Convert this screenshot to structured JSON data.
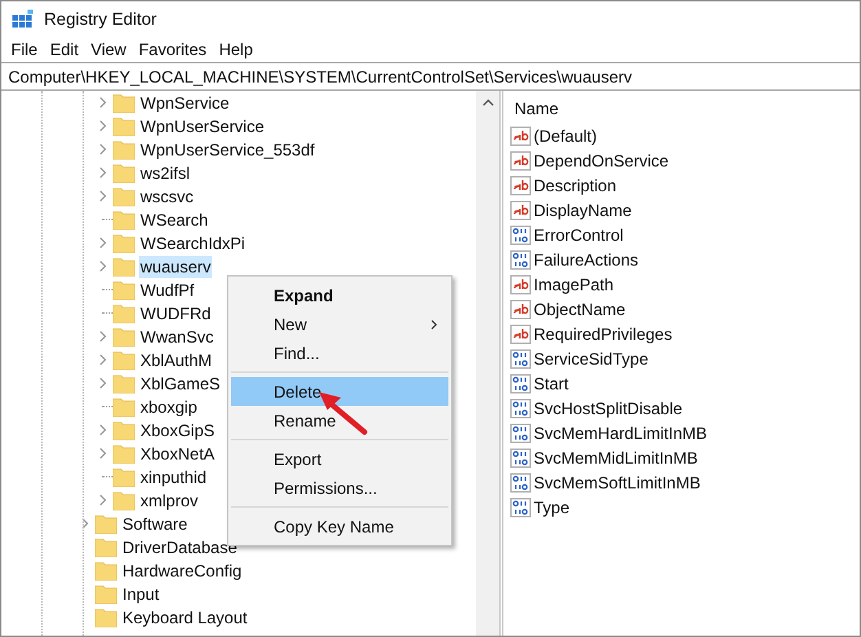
{
  "window": {
    "title": "Registry Editor"
  },
  "menu": [
    "File",
    "Edit",
    "View",
    "Favorites",
    "Help"
  ],
  "address": "Computer\\HKEY_LOCAL_MACHINE\\SYSTEM\\CurrentControlSet\\Services\\wuauserv",
  "tree": {
    "children": [
      {
        "children": [
          {
            "children": [
              {
                "label": "WpnService",
                "expandable": true,
                "selected": false
              },
              {
                "label": "WpnUserService",
                "expandable": true,
                "selected": false
              },
              {
                "label": "WpnUserService_553df",
                "expandable": true,
                "selected": false
              },
              {
                "label": "ws2ifsl",
                "expandable": true,
                "selected": false
              },
              {
                "label": "wscsvc",
                "expandable": true,
                "selected": false
              },
              {
                "label": "WSearch",
                "expandable": false,
                "selected": false
              },
              {
                "label": "WSearchIdxPi",
                "expandable": true,
                "selected": false
              },
              {
                "label": "wuauserv",
                "expandable": true,
                "selected": true
              },
              {
                "label": "WudfPf",
                "expandable": false,
                "selected": false
              },
              {
                "label": "WUDFRd",
                "expandable": false,
                "selected": false
              },
              {
                "label": "WwanSvc",
                "expandable": true,
                "selected": false
              },
              {
                "label": "XblAuthM",
                "expandable": true,
                "selected": false
              },
              {
                "label": "XblGameS",
                "expandable": true,
                "selected": false
              },
              {
                "label": "xboxgip",
                "expandable": false,
                "selected": false
              },
              {
                "label": "XboxGipS",
                "expandable": true,
                "selected": false
              },
              {
                "label": "XboxNetA",
                "expandable": true,
                "selected": false
              },
              {
                "label": "xinputhid",
                "expandable": false,
                "selected": false
              },
              {
                "label": "xmlprov",
                "expandable": true,
                "selected": false
              }
            ]
          },
          {
            "label": "Software",
            "expandable": true,
            "selected": false
          }
        ]
      },
      {
        "label": "DriverDatabase",
        "expandable": false,
        "selected": false
      },
      {
        "label": "HardwareConfig",
        "expandable": false,
        "selected": false
      },
      {
        "label": "Input",
        "expandable": false,
        "selected": false
      },
      {
        "label": "Keyboard Layout",
        "expandable": false,
        "selected": false
      }
    ]
  },
  "values": {
    "column": "Name",
    "rows": [
      {
        "name": "(Default)",
        "kind": "string"
      },
      {
        "name": "DependOnService",
        "kind": "string"
      },
      {
        "name": "Description",
        "kind": "string"
      },
      {
        "name": "DisplayName",
        "kind": "string"
      },
      {
        "name": "ErrorControl",
        "kind": "binary"
      },
      {
        "name": "FailureActions",
        "kind": "binary"
      },
      {
        "name": "ImagePath",
        "kind": "string"
      },
      {
        "name": "ObjectName",
        "kind": "string"
      },
      {
        "name": "RequiredPrivileges",
        "kind": "string"
      },
      {
        "name": "ServiceSidType",
        "kind": "binary"
      },
      {
        "name": "Start",
        "kind": "binary"
      },
      {
        "name": "SvcHostSplitDisable",
        "kind": "binary"
      },
      {
        "name": "SvcMemHardLimitInMB",
        "kind": "binary"
      },
      {
        "name": "SvcMemMidLimitInMB",
        "kind": "binary"
      },
      {
        "name": "SvcMemSoftLimitInMB",
        "kind": "binary"
      },
      {
        "name": "Type",
        "kind": "binary"
      }
    ]
  },
  "context_menu": {
    "groups": [
      [
        {
          "label": "Expand",
          "bold": true,
          "selected": false,
          "submenu": false
        },
        {
          "label": "New",
          "bold": false,
          "selected": false,
          "submenu": true
        },
        {
          "label": "Find...",
          "bold": false,
          "selected": false,
          "submenu": false
        }
      ],
      [
        {
          "label": "Delete",
          "bold": false,
          "selected": true,
          "submenu": false
        },
        {
          "label": "Rename",
          "bold": false,
          "selected": false,
          "submenu": false
        }
      ],
      [
        {
          "label": "Export",
          "bold": false,
          "selected": false,
          "submenu": false
        },
        {
          "label": "Permissions...",
          "bold": false,
          "selected": false,
          "submenu": false
        }
      ],
      [
        {
          "label": "Copy Key Name",
          "bold": false,
          "selected": false,
          "submenu": false
        }
      ]
    ]
  }
}
